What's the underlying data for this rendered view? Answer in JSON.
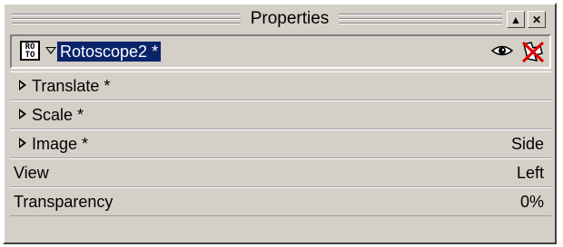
{
  "window": {
    "title": "Properties"
  },
  "header": {
    "object_name": "Rotoscope2 *",
    "type_icon": {
      "name": "rotoscope-icon",
      "line1": "RO",
      "line2": "TO"
    }
  },
  "rows": [
    {
      "label": "Translate *",
      "value": "",
      "expandable": true
    },
    {
      "label": "Scale *",
      "value": "",
      "expandable": true
    },
    {
      "label": "Image *",
      "value": "Side",
      "expandable": true
    },
    {
      "label": "View",
      "value": "Left",
      "expandable": false
    },
    {
      "label": "Transparency",
      "value": "0%",
      "expandable": false
    }
  ]
}
